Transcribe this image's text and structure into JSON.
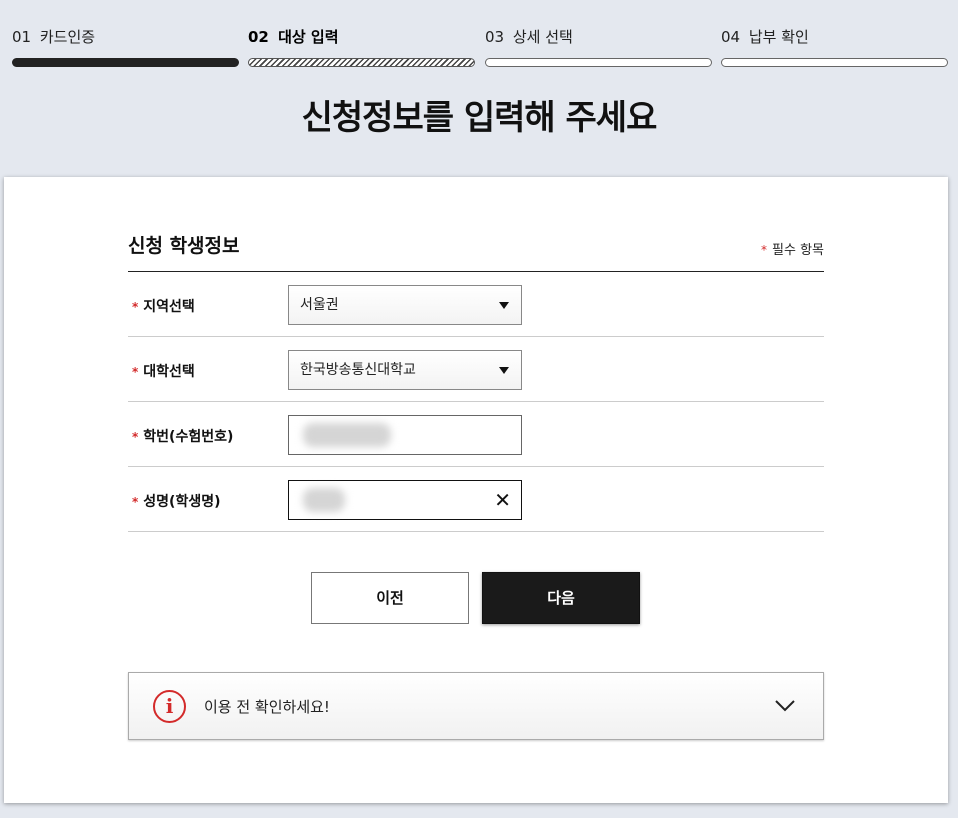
{
  "steps": [
    {
      "num": "01",
      "label": "카드인증",
      "state": "done"
    },
    {
      "num": "02",
      "label": "대상 입력",
      "state": "active"
    },
    {
      "num": "03",
      "label": "상세 선택",
      "state": "todo"
    },
    {
      "num": "04",
      "label": "납부 확인",
      "state": "todo"
    }
  ],
  "page_title": "신청정보를 입력해 주세요",
  "section": {
    "title": "신청 학생정보",
    "required_star": "*",
    "required_note": "필수 항목"
  },
  "form": {
    "region": {
      "label": "지역선택",
      "value": "서울권"
    },
    "university": {
      "label": "대학선택",
      "value": "한국방송통신대학교"
    },
    "student_id": {
      "label": "학번(수험번호)",
      "value": ""
    },
    "student_name": {
      "label": "성명(학생명)",
      "value": "",
      "clear_icon": "close-icon"
    }
  },
  "buttons": {
    "prev": "이전",
    "next": "다음"
  },
  "notice": {
    "text": "이용 전 확인하세요!",
    "icon": "info-icon",
    "toggle_icon": "chevron-down-icon"
  },
  "colors": {
    "accent_red": "#d32a2a",
    "primary_dark": "#1a1a1a",
    "page_bg": "#e4e8ef"
  }
}
